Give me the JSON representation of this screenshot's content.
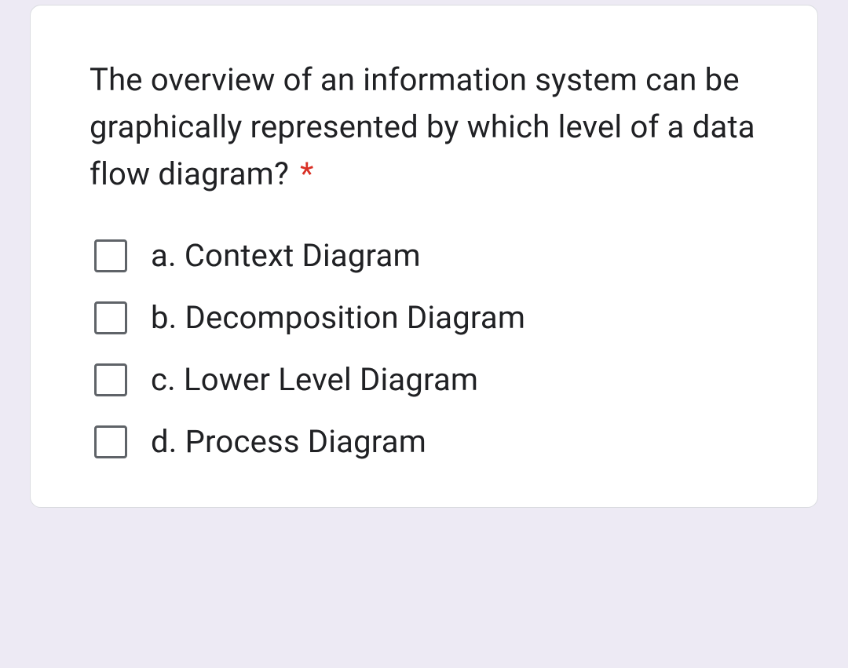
{
  "question": {
    "text": "The overview of an information system can be graphically represented by which level of a data flow diagram?",
    "required_marker": "*"
  },
  "options": [
    {
      "label": "a. Context Diagram"
    },
    {
      "label": "b. Decomposition Diagram"
    },
    {
      "label": "c. Lower Level Diagram"
    },
    {
      "label": "d. Process Diagram"
    }
  ]
}
